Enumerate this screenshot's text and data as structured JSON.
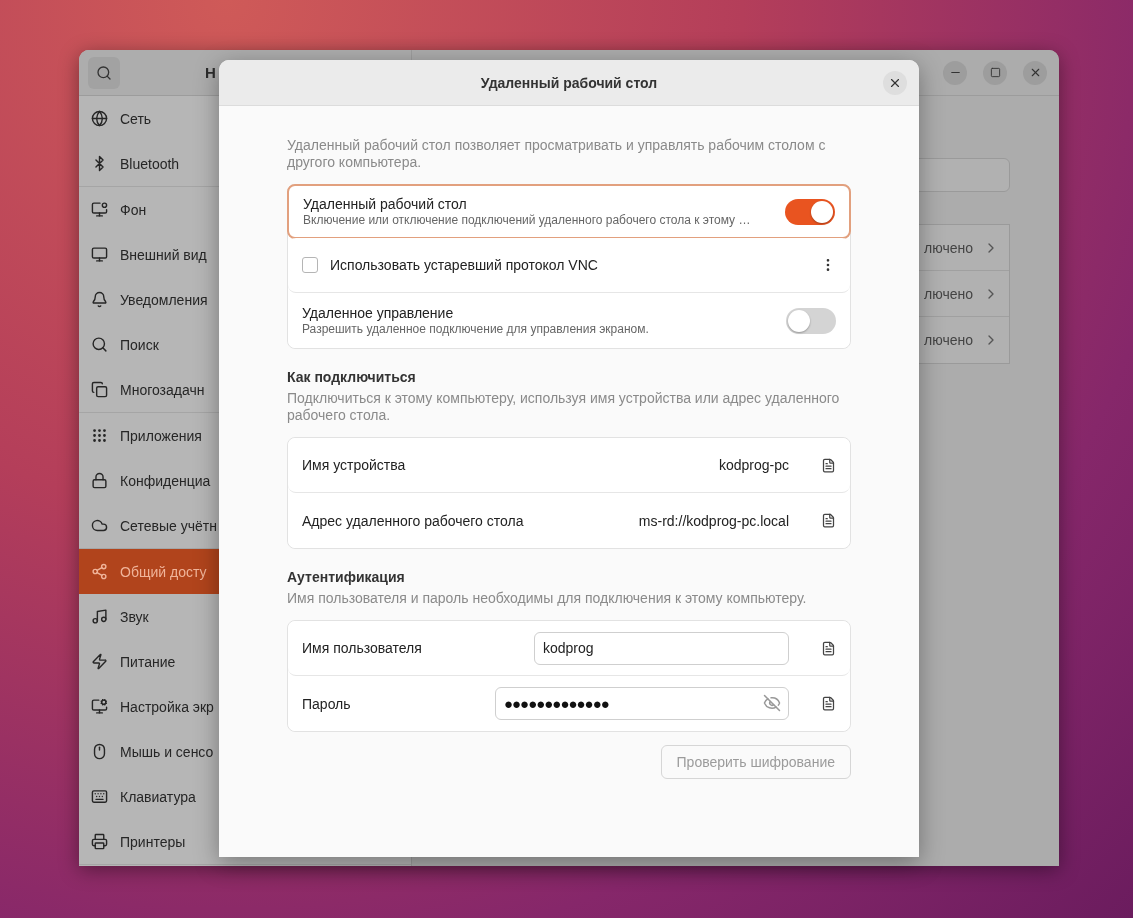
{
  "main_window": {
    "title": "Н",
    "sidebar": {
      "groups": [
        {
          "items": [
            {
              "label": "Сеть",
              "selected": false
            },
            {
              "label": "Bluetooth",
              "selected": false
            }
          ]
        },
        {
          "items": [
            {
              "label": "Фон",
              "selected": false
            },
            {
              "label": "Внешний вид",
              "selected": false
            },
            {
              "label": "Уведомления",
              "selected": false
            },
            {
              "label": "Поиск",
              "selected": false
            },
            {
              "label": "Многозадачн",
              "selected": false
            }
          ]
        },
        {
          "items": [
            {
              "label": "Приложения",
              "selected": false
            },
            {
              "label": "Конфиденциа",
              "selected": false
            },
            {
              "label": "Сетевые учётн",
              "selected": false
            }
          ]
        },
        {
          "items": [
            {
              "label": "Общий досту",
              "selected": true
            },
            {
              "label": "Звук",
              "selected": false
            },
            {
              "label": "Питание",
              "selected": false
            },
            {
              "label": "Настройка экр",
              "selected": false
            },
            {
              "label": "Мышь и сенсо",
              "selected": false
            },
            {
              "label": "Клавиатура",
              "selected": false
            },
            {
              "label": "Принтеры",
              "selected": false
            }
          ]
        }
      ]
    },
    "content": {
      "rows": [
        {
          "value": "лючено"
        },
        {
          "value": "лючено"
        },
        {
          "value": "лючено"
        }
      ]
    }
  },
  "dialog": {
    "title": "Удаленный рабочий стол",
    "intro": "Удаленный рабочий стол позволяет просматривать и управлять рабочим столом с другого компьютера.",
    "settings": [
      {
        "kind": "switch",
        "title": "Удаленный рабочий стол",
        "subtitle": "Включение или отключение подключений удаленного рабочего стола к этому …",
        "on": true,
        "focused": true
      },
      {
        "kind": "checkbox",
        "label": "Использовать устаревший протокол VNC",
        "checked": false
      },
      {
        "kind": "switch",
        "title": "Удаленное управление",
        "subtitle": "Разрешить удаленное подключение для управления экраном.",
        "on": false,
        "focused": false
      }
    ],
    "sections": [
      {
        "heading": "Как подключиться",
        "description": "Подключиться к этому компьютеру, используя имя устройства или адрес удаленного рабочего стола.",
        "rows": [
          {
            "kind": "info",
            "label": "Имя устройства",
            "value": "kodprog-pc"
          },
          {
            "kind": "info",
            "label": "Адрес удаленного рабочего стола",
            "value": "ms-rd://kodprog-pc.local"
          }
        ]
      },
      {
        "heading": "Аутентификация",
        "description": "Имя пользователя и пароль необходимы для подключения к этому компьютеру.",
        "rows": [
          {
            "kind": "text",
            "label": "Имя пользователя",
            "value": "kodprog"
          },
          {
            "kind": "password",
            "label": "Пароль",
            "value": "●●●●●●●●●●●●●"
          }
        ]
      }
    ],
    "verify_button": {
      "label": "Проверить шифрование",
      "disabled": true
    }
  }
}
